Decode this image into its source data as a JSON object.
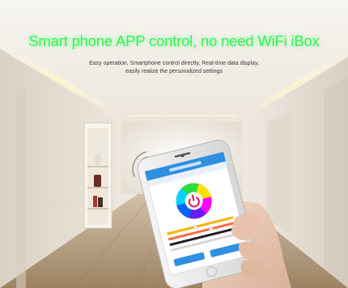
{
  "headline": "Smart phone APP control, no need WiFi iBox",
  "subtitle_line1": "Easy operation, Smartphone control directly, Real-time data display,",
  "subtitle_line2": "easily realize the personalized settings",
  "colors": {
    "headline": "#38f25a",
    "app_bar": "#2f8fe0",
    "wall": "#e9e4dc",
    "floor": "#b49b7c"
  },
  "icons": [
    "wifi-signal-icon",
    "power-icon",
    "color-wheel-icon"
  ]
}
